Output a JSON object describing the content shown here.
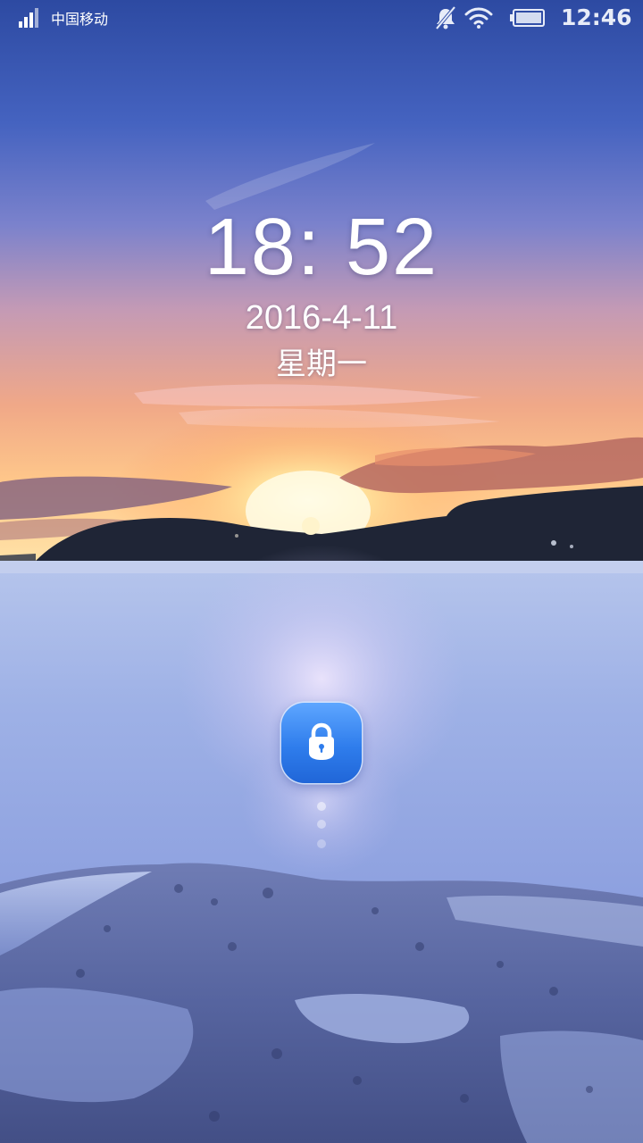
{
  "status_bar": {
    "carrier": "中国移动",
    "time": "12:46",
    "icons": [
      "signal-icon",
      "mute-icon",
      "wifi-icon",
      "battery-icon"
    ]
  },
  "lockscreen": {
    "time": "18: 52",
    "date": "2016-4-11",
    "weekday": "星期一",
    "unlock_icon": "lock-icon",
    "accent_color": "#2f7dec"
  }
}
